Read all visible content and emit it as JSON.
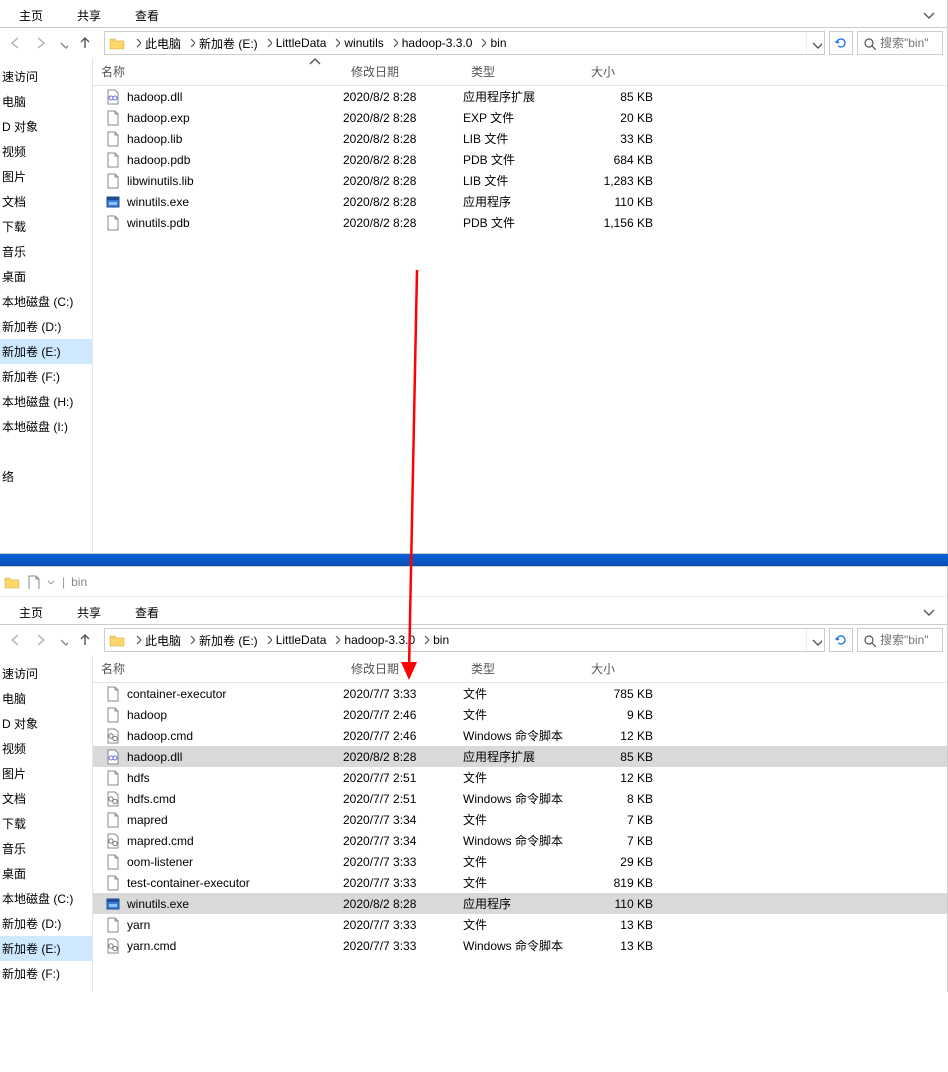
{
  "ribbon": {
    "home": "主页",
    "share": "共享",
    "view": "查看"
  },
  "breadcrumb1": {
    "segments": [
      "此电脑",
      "新加卷 (E:)",
      "LittleData",
      "winutils",
      "hadoop-3.3.0",
      "bin"
    ],
    "search_placeholder": "搜索\"bin\""
  },
  "breadcrumb2": {
    "segments": [
      "此电脑",
      "新加卷 (E:)",
      "LittleData",
      "hadoop-3.3.0",
      "bin"
    ],
    "search_placeholder": "搜索\"bin\""
  },
  "columns": {
    "name": "名称",
    "date": "修改日期",
    "type": "类型",
    "size": "大小"
  },
  "sidebar": {
    "items": [
      "速访问",
      "电脑",
      "D 对象",
      "视频",
      "图片",
      "文档",
      "下载",
      "音乐",
      "桌面",
      "本地磁盘 (C:)",
      "新加卷 (D:)",
      "新加卷 (E:)",
      "新加卷 (F:)",
      "本地磁盘 (H:)",
      "本地磁盘 (I:)",
      "",
      "络"
    ],
    "selected_index_top": 11
  },
  "sidebar2_selected_index": 11,
  "titlebar2": {
    "title": "bin"
  },
  "files_top": [
    {
      "icon": "dll",
      "name": "hadoop.dll",
      "date": "2020/8/2 8:28",
      "type": "应用程序扩展",
      "size": "85 KB"
    },
    {
      "icon": "file",
      "name": "hadoop.exp",
      "date": "2020/8/2 8:28",
      "type": "EXP 文件",
      "size": "20 KB"
    },
    {
      "icon": "file",
      "name": "hadoop.lib",
      "date": "2020/8/2 8:28",
      "type": "LIB 文件",
      "size": "33 KB"
    },
    {
      "icon": "file",
      "name": "hadoop.pdb",
      "date": "2020/8/2 8:28",
      "type": "PDB 文件",
      "size": "684 KB"
    },
    {
      "icon": "file",
      "name": "libwinutils.lib",
      "date": "2020/8/2 8:28",
      "type": "LIB 文件",
      "size": "1,283 KB"
    },
    {
      "icon": "exe",
      "name": "winutils.exe",
      "date": "2020/8/2 8:28",
      "type": "应用程序",
      "size": "110 KB"
    },
    {
      "icon": "file",
      "name": "winutils.pdb",
      "date": "2020/8/2 8:28",
      "type": "PDB 文件",
      "size": "1,156 KB"
    }
  ],
  "files_bottom": [
    {
      "icon": "file",
      "name": "container-executor",
      "date": "2020/7/7 3:33",
      "type": "文件",
      "size": "785 KB",
      "highlight": false
    },
    {
      "icon": "file",
      "name": "hadoop",
      "date": "2020/7/7 2:46",
      "type": "文件",
      "size": "9 KB",
      "highlight": false
    },
    {
      "icon": "cmd",
      "name": "hadoop.cmd",
      "date": "2020/7/7 2:46",
      "type": "Windows 命令脚本",
      "size": "12 KB",
      "highlight": false
    },
    {
      "icon": "dll",
      "name": "hadoop.dll",
      "date": "2020/8/2 8:28",
      "type": "应用程序扩展",
      "size": "85 KB",
      "highlight": true
    },
    {
      "icon": "file",
      "name": "hdfs",
      "date": "2020/7/7 2:51",
      "type": "文件",
      "size": "12 KB",
      "highlight": false
    },
    {
      "icon": "cmd",
      "name": "hdfs.cmd",
      "date": "2020/7/7 2:51",
      "type": "Windows 命令脚本",
      "size": "8 KB",
      "highlight": false
    },
    {
      "icon": "file",
      "name": "mapred",
      "date": "2020/7/7 3:34",
      "type": "文件",
      "size": "7 KB",
      "highlight": false
    },
    {
      "icon": "cmd",
      "name": "mapred.cmd",
      "date": "2020/7/7 3:34",
      "type": "Windows 命令脚本",
      "size": "7 KB",
      "highlight": false
    },
    {
      "icon": "file",
      "name": "oom-listener",
      "date": "2020/7/7 3:33",
      "type": "文件",
      "size": "29 KB",
      "highlight": false
    },
    {
      "icon": "file",
      "name": "test-container-executor",
      "date": "2020/7/7 3:33",
      "type": "文件",
      "size": "819 KB",
      "highlight": false
    },
    {
      "icon": "exe",
      "name": "winutils.exe",
      "date": "2020/8/2 8:28",
      "type": "应用程序",
      "size": "110 KB",
      "highlight": true
    },
    {
      "icon": "file",
      "name": "yarn",
      "date": "2020/7/7 3:33",
      "type": "文件",
      "size": "13 KB",
      "highlight": false
    },
    {
      "icon": "cmd",
      "name": "yarn.cmd",
      "date": "2020/7/7 3:33",
      "type": "Windows 命令脚本",
      "size": "13 KB",
      "highlight": false
    }
  ]
}
